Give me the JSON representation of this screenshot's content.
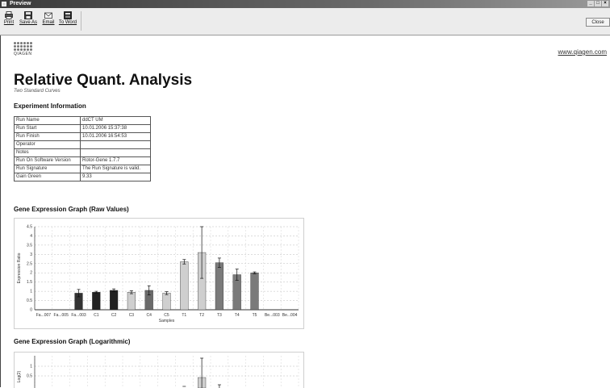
{
  "window": {
    "title": "Preview",
    "controls": [
      "_",
      "□",
      "×"
    ]
  },
  "toolbar": {
    "buttons": [
      {
        "label": "Print",
        "icon": "printer-icon"
      },
      {
        "label": "Save As",
        "icon": "save-icon"
      },
      {
        "label": "Email",
        "icon": "email-icon"
      },
      {
        "label": "To Word",
        "icon": "word-icon"
      }
    ],
    "close_label": "Close"
  },
  "report": {
    "logo_text": "QIAGEN",
    "website": "www.qiagen.com",
    "title": "Relative Quant. Analysis",
    "subtitle": "Two Standard Curves",
    "experiment_heading": "Experiment Information",
    "experiment_rows": [
      {
        "key": "Run Name",
        "value": "ddCT UM"
      },
      {
        "key": "Run Start",
        "value": "10.01.2006 15:37:38"
      },
      {
        "key": "Run Finish",
        "value": "10.01.2006 16:54:53"
      },
      {
        "key": "Operator",
        "value": ""
      },
      {
        "key": "Notes",
        "value": ""
      },
      {
        "key": "Run On Software Version",
        "value": "Rotor-Gene 1.7.7"
      },
      {
        "key": "Run Signature",
        "value": "The Run Signature is valid."
      },
      {
        "key": "Gain Green",
        "value": "9.33"
      }
    ],
    "graph1_heading": "Gene Expression Graph (Raw Values)",
    "graph2_heading": "Gene Expression Graph (Logarithmic)"
  },
  "chart_data": [
    {
      "type": "bar",
      "title": "Gene Expression Graph (Raw Values)",
      "xlabel": "Samples",
      "ylabel": "Expression Ratio",
      "ylim": [
        0,
        4.5
      ],
      "yticks": [
        0,
        0.5,
        1,
        1.5,
        2,
        2.5,
        3,
        3.5,
        4,
        4.5
      ],
      "grid": true,
      "categories": [
        "Fa...007",
        "Fa...005",
        "Fa...003",
        "C1",
        "C2",
        "C3",
        "C4",
        "C5",
        "T1",
        "T2",
        "T3",
        "T4",
        "T5",
        "Be...003",
        "Be...004"
      ],
      "values": [
        0,
        0,
        0.9,
        0.95,
        1.05,
        0.95,
        1.05,
        0.9,
        2.6,
        3.1,
        2.55,
        1.9,
        2.0,
        0,
        0
      ],
      "errors": [
        0,
        0,
        0.2,
        0.05,
        0.08,
        0.08,
        0.25,
        0.08,
        0.12,
        1.4,
        0.25,
        0.3,
        0.05,
        0,
        0
      ],
      "colors": [
        "#333333",
        "#333333",
        "#333333",
        "#222222",
        "#222222",
        "#cfcfcf",
        "#6a6a6a",
        "#cfcfcf",
        "#cfcfcf",
        "#cfcfcf",
        "#7a7a7a",
        "#7a7a7a",
        "#7a7a7a",
        "#333333",
        "#333333"
      ]
    },
    {
      "type": "bar",
      "title": "Gene Expression Graph (Logarithmic)",
      "ylabel": "Log(2)",
      "yticks": [
        0.5,
        1
      ],
      "grid": true
    }
  ]
}
